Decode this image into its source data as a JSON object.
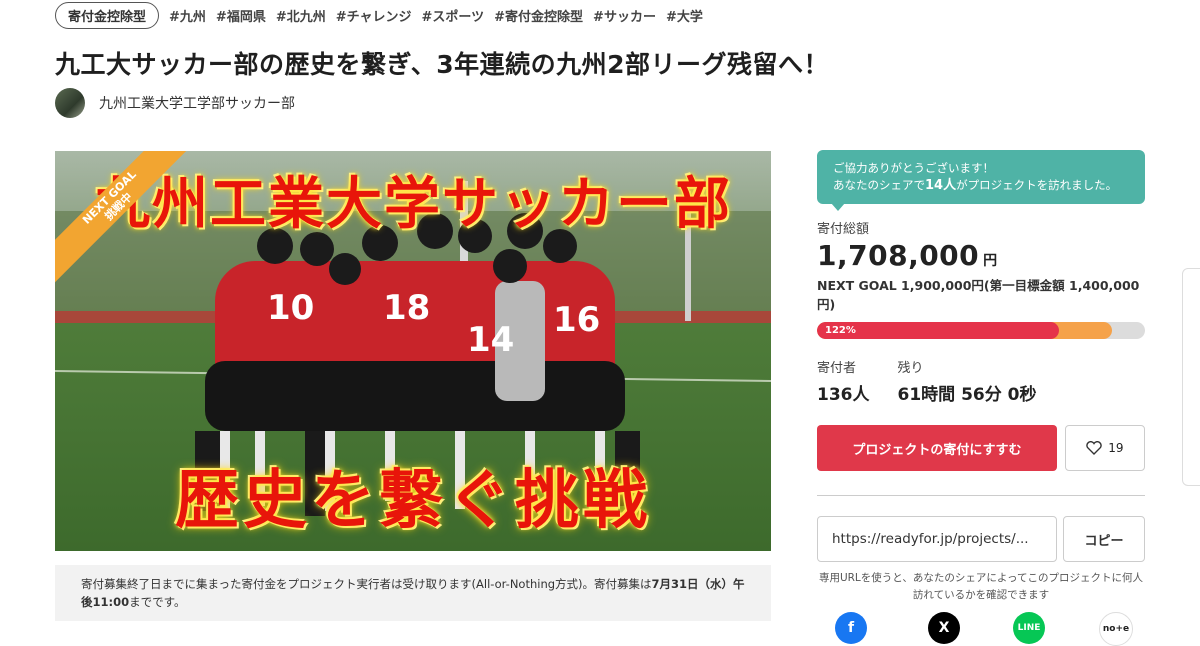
{
  "tags": {
    "category": "寄付金控除型",
    "hashtags": [
      "#九州",
      "#福岡県",
      "#北九州",
      "#チャレンジ",
      "#スポーツ",
      "#寄付金控除型",
      "#サッカー",
      "#大学"
    ]
  },
  "project": {
    "title": "九工大サッカー部の歴史を繋ぎ、3年連続の九州2部リーグ残留へ！",
    "owner": "九州工業大学工学部サッカー部"
  },
  "hero": {
    "title_top": "九州工業大学サッカー部",
    "title_bottom": "歴史を繋ぐ挑戦",
    "ribbon_line1": "NEXT GOAL",
    "ribbon_line2": "挑戦中",
    "jersey_numbers": [
      "10",
      "18",
      "14",
      "16"
    ]
  },
  "notice": {
    "text_before": "寄付募集終了日までに集まった寄付金をプロジェクト実行者は受け取ります(All-or-Nothing方式)。寄付募集は",
    "deadline": "7月31日（水）午後11:00",
    "text_after": "までです。"
  },
  "sidebar": {
    "thanks_line1": "ご協力ありがとうございます！",
    "thanks_line2_pre": "あなたのシェアで",
    "thanks_count": "14人",
    "thanks_line2_post": "がプロジェクトを訪れました。",
    "total_label": "寄付総額",
    "total_amount": "1,708,000",
    "total_unit": "円",
    "next_goal": "NEXT GOAL 1,900,000円(第一目標金額 1,400,000円)",
    "progress_label": "122%",
    "progress_fraction": 0.8989,
    "first_goal_fraction": 0.7368,
    "supporters_label": "寄付者",
    "supporters_value": "136人",
    "remaining_label": "残り",
    "remaining_value": "61時間 56分 0秒",
    "donate_button": "プロジェクトの寄付にすすむ",
    "like_count": "19",
    "url_value": "https://readyfor.jp/projects/...",
    "copy_button": "コピー",
    "url_note": "専用URLを使うと、あなたのシェアによってこのプロジェクトに何人訪れているかを確認できます"
  },
  "social": {
    "x_label": "X",
    "line_label": "LINE",
    "note_label": "no+e"
  },
  "colors": {
    "accent_red": "#e0384a",
    "teal": "#4fb3a6",
    "orange": "#f5a24a"
  }
}
